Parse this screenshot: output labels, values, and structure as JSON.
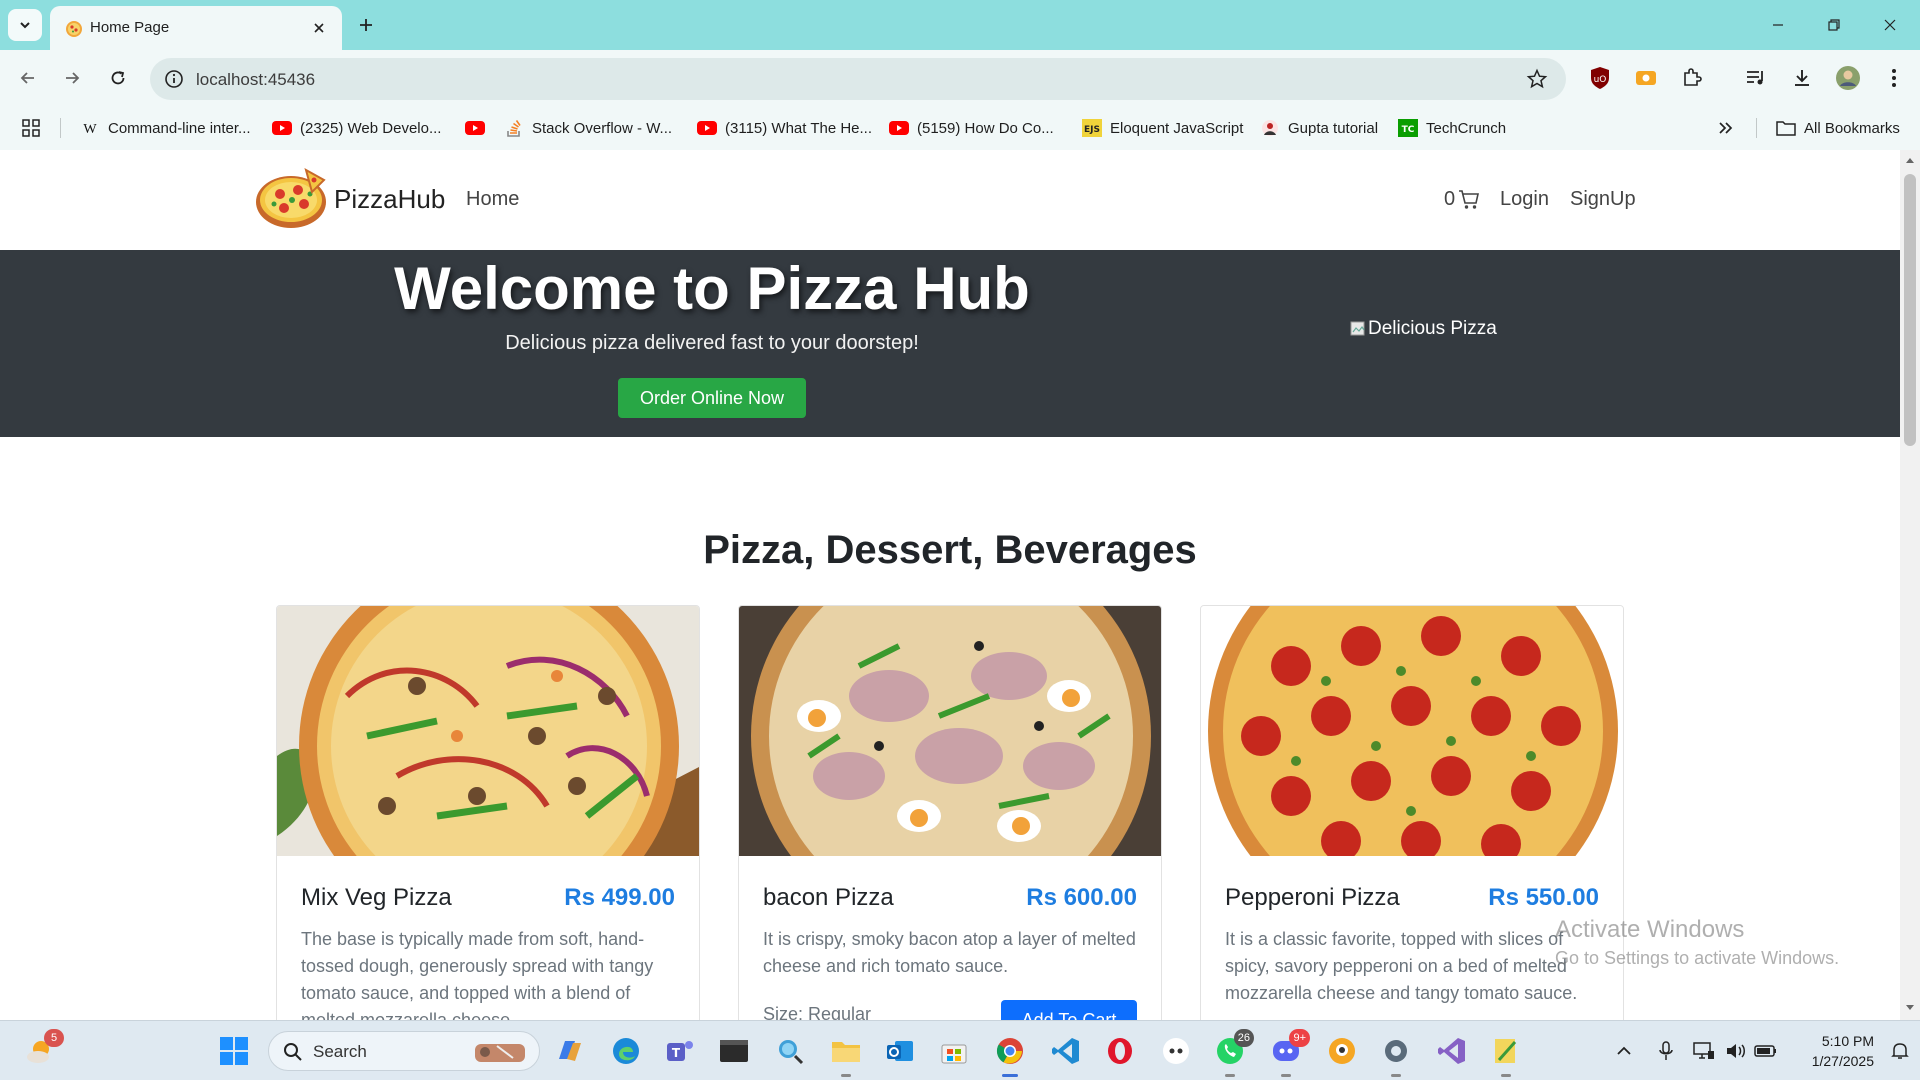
{
  "browser": {
    "tab_title": "Home Page",
    "url": "localhost:45436",
    "bookmarks": [
      {
        "label": "Command-line inter...",
        "icon": "wikipedia-icon"
      },
      {
        "label": "(2325) Web Develo...",
        "icon": "youtube-icon"
      },
      {
        "label": "",
        "icon": "youtube-icon"
      },
      {
        "label": "Stack Overflow - W...",
        "icon": "stackoverflow-icon"
      },
      {
        "label": "(3115) What The He...",
        "icon": "youtube-icon"
      },
      {
        "label": "(5159) How Do Co...",
        "icon": "youtube-icon"
      },
      {
        "label": "Eloquent JavaScript",
        "icon": "ejs-icon"
      },
      {
        "label": "Gupta tutorial",
        "icon": "gupta-icon"
      },
      {
        "label": "TechCrunch",
        "icon": "techcrunch-icon"
      }
    ],
    "all_bookmarks": "All Bookmarks"
  },
  "navbar": {
    "brand": "PizzaHub",
    "home": "Home",
    "cart_count": "0",
    "login": "Login",
    "signup": "SignUp"
  },
  "hero": {
    "title": "Welcome to Pizza Hub",
    "subtitle": "Delicious pizza delivered fast to your doorstep!",
    "button": "Order Online Now",
    "image_alt": "Delicious Pizza"
  },
  "menu": {
    "title": "Pizza, Dessert, Beverages",
    "cards": [
      {
        "name": "Mix Veg Pizza",
        "price": "Rs 499.00",
        "description": "The base is typically made from soft, hand-tossed dough, generously spread with tangy tomato sauce, and topped with a blend of melted mozzarella cheese"
      },
      {
        "name": "bacon Pizza",
        "price": "Rs 600.00",
        "description": "It is crispy, smoky bacon atop a layer of melted cheese and rich tomato sauce.",
        "size": "Size: Regular",
        "button": "Add To Cart"
      },
      {
        "name": "Pepperoni Pizza",
        "price": "Rs 550.00",
        "description": "It is a classic favorite, topped with slices of spicy, savory pepperoni on a bed of melted mozzarella cheese and tangy tomato sauce."
      }
    ]
  },
  "watermark": {
    "line1": "Activate Windows",
    "line2": "Go to Settings to activate Windows."
  },
  "taskbar": {
    "search": "Search",
    "weather_badge": "5",
    "whatsapp_badge": "26",
    "discord_badge": "9+",
    "time": "5:10 PM",
    "date": "1/27/2025"
  },
  "colors": {
    "tabstrip": "#8ddede",
    "hero_bg": "#343a40",
    "order_button": "#28a745",
    "price": "#1e7de0",
    "add_to_cart": "#0d6efd"
  }
}
